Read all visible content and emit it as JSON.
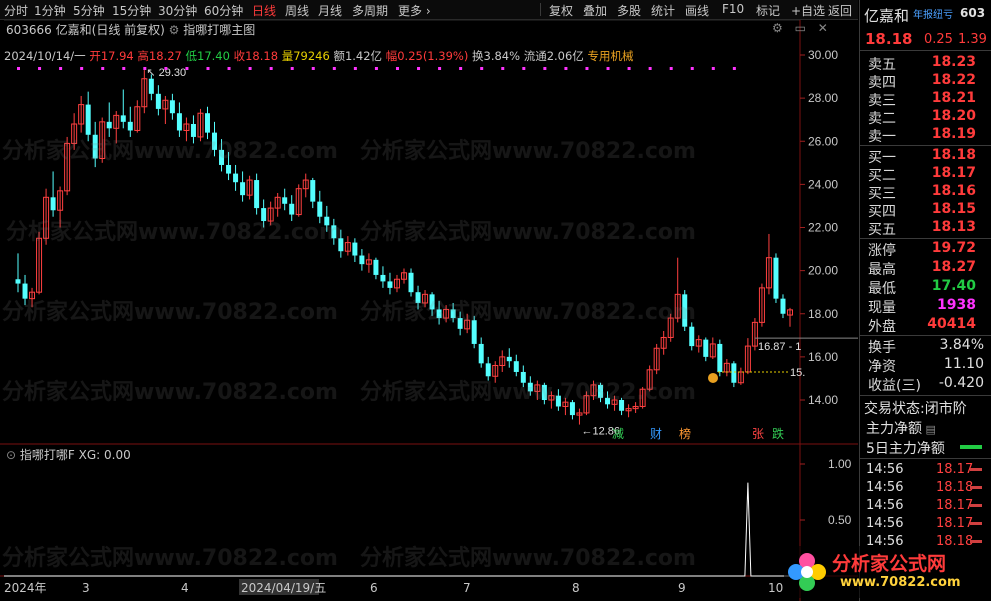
{
  "toolbar": {
    "items": [
      "分时",
      "1分钟",
      "5分钟",
      "15分钟",
      "30分钟",
      "60分钟",
      "日线",
      "周线",
      "月线",
      "多周期",
      "更多 ›"
    ],
    "active": "日线",
    "right_items": [
      "复权",
      "叠加",
      "多股",
      "统计",
      "画线",
      "F10",
      "标记",
      "+自选",
      "返回"
    ]
  },
  "stock": {
    "code": "603666",
    "name": "亿嘉和",
    "period_label": "(日线 前复权)",
    "indicator_main": "指哪打哪主图",
    "date": "2024/10/14/一",
    "open_label": "开",
    "open": "17.94",
    "high_label": "高",
    "high": "18.27",
    "low_label": "低",
    "low": "17.40",
    "close_label": "收",
    "close": "18.18",
    "vol_label": "量",
    "vol": "79246",
    "amt_label": "额",
    "amt": "1.42亿",
    "chg_label": "幅",
    "chg": "0.25(1.39%)",
    "turn_label": "换",
    "turn": "3.84%",
    "float_label": "流通",
    "float": "2.06亿",
    "sector": "专用机械"
  },
  "chart_labels": {
    "high_mark": "29.30",
    "low_mark": "←12.86",
    "ray_label": "16.87 - 1",
    "ray_label2": "15.",
    "event_tags": [
      {
        "text": "减",
        "color": "#33cc55"
      },
      {
        "text": "财",
        "color": "#3399ff"
      },
      {
        "text": "榜",
        "color": "#ff9933"
      },
      {
        "text": "张",
        "color": "#ff4444"
      },
      {
        "text": "跌",
        "color": "#33cc55"
      }
    ]
  },
  "y_axis": {
    "ticks": [
      "30.00",
      "28.00",
      "26.00",
      "24.00",
      "22.00",
      "20.00",
      "18.00",
      "16.00",
      "14.00"
    ],
    "sub_ticks": [
      "1.00",
      "0.50"
    ]
  },
  "x_axis": {
    "labels": [
      "2024年",
      "3",
      "4",
      "2024/04/19/五",
      "6",
      "7",
      "8",
      "9",
      "10"
    ]
  },
  "sub_indicator": {
    "name": "指哪打哪F",
    "value_text": "XG: 0.00"
  },
  "chart_data": {
    "type": "candlestick",
    "title": "",
    "ylim": [
      12,
      31
    ],
    "candles": [
      [
        19.6,
        20.8,
        19.0,
        19.4
      ],
      [
        19.4,
        19.8,
        18.4,
        18.7
      ],
      [
        18.7,
        19.2,
        18.3,
        19.0
      ],
      [
        19.0,
        21.8,
        18.9,
        21.5
      ],
      [
        21.5,
        23.8,
        21.2,
        23.4
      ],
      [
        23.4,
        24.6,
        22.5,
        22.8
      ],
      [
        22.8,
        23.9,
        22.0,
        23.7
      ],
      [
        23.7,
        26.2,
        23.5,
        25.9
      ],
      [
        25.9,
        27.3,
        25.6,
        26.8
      ],
      [
        26.8,
        28.1,
        26.4,
        27.7
      ],
      [
        27.7,
        28.3,
        26.0,
        26.3
      ],
      [
        26.3,
        26.9,
        24.8,
        25.2
      ],
      [
        25.2,
        27.1,
        25.0,
        26.9
      ],
      [
        26.9,
        27.8,
        26.2,
        26.6
      ],
      [
        26.6,
        27.4,
        25.9,
        27.2
      ],
      [
        27.2,
        28.4,
        26.6,
        26.9
      ],
      [
        26.9,
        27.6,
        26.2,
        26.5
      ],
      [
        26.5,
        27.9,
        26.4,
        27.6
      ],
      [
        27.6,
        29.3,
        27.3,
        28.9
      ],
      [
        28.9,
        29.1,
        27.9,
        28.2
      ],
      [
        28.2,
        28.6,
        27.2,
        27.5
      ],
      [
        27.5,
        28.1,
        26.8,
        27.9
      ],
      [
        27.9,
        28.2,
        27.0,
        27.3
      ],
      [
        27.3,
        27.8,
        26.2,
        26.5
      ],
      [
        26.5,
        27.1,
        26.0,
        26.8
      ],
      [
        26.8,
        27.2,
        25.9,
        26.2
      ],
      [
        26.2,
        27.5,
        26.0,
        27.3
      ],
      [
        27.3,
        27.6,
        26.1,
        26.4
      ],
      [
        26.4,
        26.9,
        25.3,
        25.6
      ],
      [
        25.6,
        26.1,
        24.6,
        24.9
      ],
      [
        24.9,
        25.5,
        24.2,
        24.5
      ],
      [
        24.5,
        24.9,
        23.7,
        24.1
      ],
      [
        24.1,
        24.6,
        23.2,
        23.5
      ],
      [
        23.5,
        24.4,
        23.3,
        24.2
      ],
      [
        24.2,
        24.5,
        22.6,
        22.9
      ],
      [
        22.9,
        23.3,
        22.0,
        22.3
      ],
      [
        22.3,
        23.2,
        22.1,
        22.9
      ],
      [
        22.9,
        23.6,
        22.5,
        23.4
      ],
      [
        23.4,
        23.8,
        22.8,
        23.1
      ],
      [
        23.1,
        23.5,
        22.3,
        22.6
      ],
      [
        22.6,
        24.0,
        22.5,
        23.8
      ],
      [
        23.8,
        24.5,
        23.4,
        24.2
      ],
      [
        24.2,
        24.3,
        22.9,
        23.2
      ],
      [
        23.2,
        23.7,
        22.2,
        22.5
      ],
      [
        22.5,
        23.0,
        21.8,
        22.1
      ],
      [
        22.1,
        22.4,
        21.2,
        21.5
      ],
      [
        21.5,
        21.9,
        20.6,
        20.9
      ],
      [
        20.9,
        21.6,
        20.7,
        21.3
      ],
      [
        21.3,
        21.5,
        20.4,
        20.7
      ],
      [
        20.7,
        21.0,
        20.0,
        20.3
      ],
      [
        20.3,
        20.8,
        19.9,
        20.5
      ],
      [
        20.5,
        20.6,
        19.6,
        19.8
      ],
      [
        19.8,
        20.2,
        19.2,
        19.5
      ],
      [
        19.5,
        19.9,
        18.9,
        19.2
      ],
      [
        19.2,
        19.8,
        19.0,
        19.6
      ],
      [
        19.6,
        20.1,
        19.4,
        19.9
      ],
      [
        19.9,
        20.1,
        18.8,
        19.0
      ],
      [
        19.0,
        19.3,
        18.2,
        18.5
      ],
      [
        18.5,
        19.1,
        18.3,
        18.9
      ],
      [
        18.9,
        19.0,
        17.9,
        18.2
      ],
      [
        18.2,
        18.6,
        17.5,
        17.8
      ],
      [
        17.8,
        18.4,
        17.6,
        18.2
      ],
      [
        18.2,
        18.5,
        17.6,
        17.8
      ],
      [
        17.8,
        18.1,
        17.0,
        17.3
      ],
      [
        17.3,
        18.0,
        17.1,
        17.7
      ],
      [
        17.7,
        17.9,
        16.4,
        16.6
      ],
      [
        16.6,
        16.9,
        15.5,
        15.7
      ],
      [
        15.7,
        16.0,
        14.9,
        15.1
      ],
      [
        15.1,
        15.8,
        14.8,
        15.6
      ],
      [
        15.6,
        16.3,
        15.3,
        16.0
      ],
      [
        16.0,
        16.4,
        15.5,
        15.8
      ],
      [
        15.8,
        16.1,
        15.1,
        15.3
      ],
      [
        15.3,
        15.6,
        14.6,
        14.8
      ],
      [
        14.8,
        15.1,
        14.2,
        14.4
      ],
      [
        14.4,
        14.9,
        14.0,
        14.7
      ],
      [
        14.7,
        14.8,
        13.8,
        14.0
      ],
      [
        14.0,
        14.4,
        13.6,
        14.2
      ],
      [
        14.2,
        14.5,
        13.5,
        13.7
      ],
      [
        13.7,
        14.1,
        13.3,
        13.9
      ],
      [
        13.9,
        14.0,
        13.1,
        13.3
      ],
      [
        13.3,
        13.6,
        12.86,
        13.4
      ],
      [
        13.4,
        14.4,
        13.3,
        14.2
      ],
      [
        14.2,
        14.9,
        14.0,
        14.7
      ],
      [
        14.7,
        14.8,
        13.9,
        14.1
      ],
      [
        14.1,
        14.4,
        13.6,
        13.8
      ],
      [
        13.8,
        14.2,
        13.5,
        14.0
      ],
      [
        14.0,
        14.1,
        13.3,
        13.5
      ],
      [
        13.5,
        13.8,
        13.2,
        13.6
      ],
      [
        13.6,
        13.9,
        13.4,
        13.7
      ],
      [
        13.7,
        14.6,
        13.6,
        14.5
      ],
      [
        14.5,
        15.6,
        14.4,
        15.4
      ],
      [
        15.4,
        16.6,
        15.2,
        16.4
      ],
      [
        16.4,
        17.2,
        16.1,
        16.9
      ],
      [
        16.9,
        18.0,
        16.7,
        17.8
      ],
      [
        17.8,
        20.6,
        17.6,
        18.9
      ],
      [
        18.9,
        19.1,
        17.2,
        17.4
      ],
      [
        17.4,
        17.6,
        16.3,
        16.5
      ],
      [
        16.5,
        17.0,
        16.2,
        16.8
      ],
      [
        16.8,
        16.9,
        15.8,
        16.0
      ],
      [
        16.0,
        16.9,
        15.9,
        16.6
      ],
      [
        16.6,
        16.8,
        15.1,
        15.3
      ],
      [
        15.3,
        15.9,
        15.1,
        15.7
      ],
      [
        15.7,
        15.8,
        14.6,
        14.8
      ],
      [
        14.8,
        15.5,
        14.7,
        15.3
      ],
      [
        15.3,
        16.87,
        15.2,
        16.5
      ],
      [
        16.5,
        17.8,
        16.3,
        17.6
      ],
      [
        17.6,
        19.4,
        17.4,
        19.2
      ],
      [
        19.2,
        21.7,
        18.9,
        20.6
      ],
      [
        20.6,
        20.8,
        18.5,
        18.7
      ],
      [
        18.7,
        18.9,
        17.8,
        18.0
      ],
      [
        17.94,
        18.27,
        17.4,
        18.18
      ]
    ],
    "sub_series": {
      "name": "XG",
      "ylim": [
        0,
        1.2
      ],
      "spike_index": 104,
      "spike_value": 1.0
    }
  },
  "panel": {
    "title": "亿嘉和",
    "title_tag": "年报纽亏",
    "code_short": "603",
    "price": "18.18",
    "change": "0.25",
    "change_pct": "1.39",
    "asks": [
      {
        "label": "卖五",
        "price": "18.23"
      },
      {
        "label": "卖四",
        "price": "18.22"
      },
      {
        "label": "卖三",
        "price": "18.21"
      },
      {
        "label": "卖二",
        "price": "18.20"
      },
      {
        "label": "卖一",
        "price": "18.19"
      }
    ],
    "bids": [
      {
        "label": "买一",
        "price": "18.18"
      },
      {
        "label": "买二",
        "price": "18.17"
      },
      {
        "label": "买三",
        "price": "18.16"
      },
      {
        "label": "买四",
        "price": "18.15"
      },
      {
        "label": "买五",
        "price": "18.13"
      }
    ],
    "stats1": [
      {
        "label": "涨停",
        "value": "19.72",
        "color": "#ff3b3b"
      },
      {
        "label": "最高",
        "value": "18.27",
        "color": "#ff3b3b"
      },
      {
        "label": "最低",
        "value": "17.40",
        "color": "#22cc44"
      },
      {
        "label": "现量",
        "value": "1938",
        "color": "#ff33ff"
      },
      {
        "label": "外盘",
        "value": "40414",
        "color": "#ff3b3b"
      }
    ],
    "stats2": [
      {
        "label": "换手",
        "value": "3.84%",
        "color": "#e0e0e0"
      },
      {
        "label": "净资",
        "value": "11.10",
        "color": "#e0e0e0"
      },
      {
        "label": "收益(三)",
        "value": "-0.420",
        "color": "#e0e0e0"
      }
    ],
    "status_label": "交易状态:",
    "status_value": "闭市阶",
    "main_net": "主力净额",
    "main_net5": "5日主力净额",
    "ticks": [
      {
        "time": "14:56",
        "price": "18.17"
      },
      {
        "time": "14:56",
        "price": "18.18"
      },
      {
        "time": "14:56",
        "price": "18.17"
      },
      {
        "time": "14:56",
        "price": "18.17"
      },
      {
        "time": "14:56",
        "price": "18.18"
      }
    ]
  },
  "watermark": {
    "text": "分析家公式网www.70822.com",
    "logo_text": "分析家公式网",
    "logo_url": "www.70822.com"
  }
}
